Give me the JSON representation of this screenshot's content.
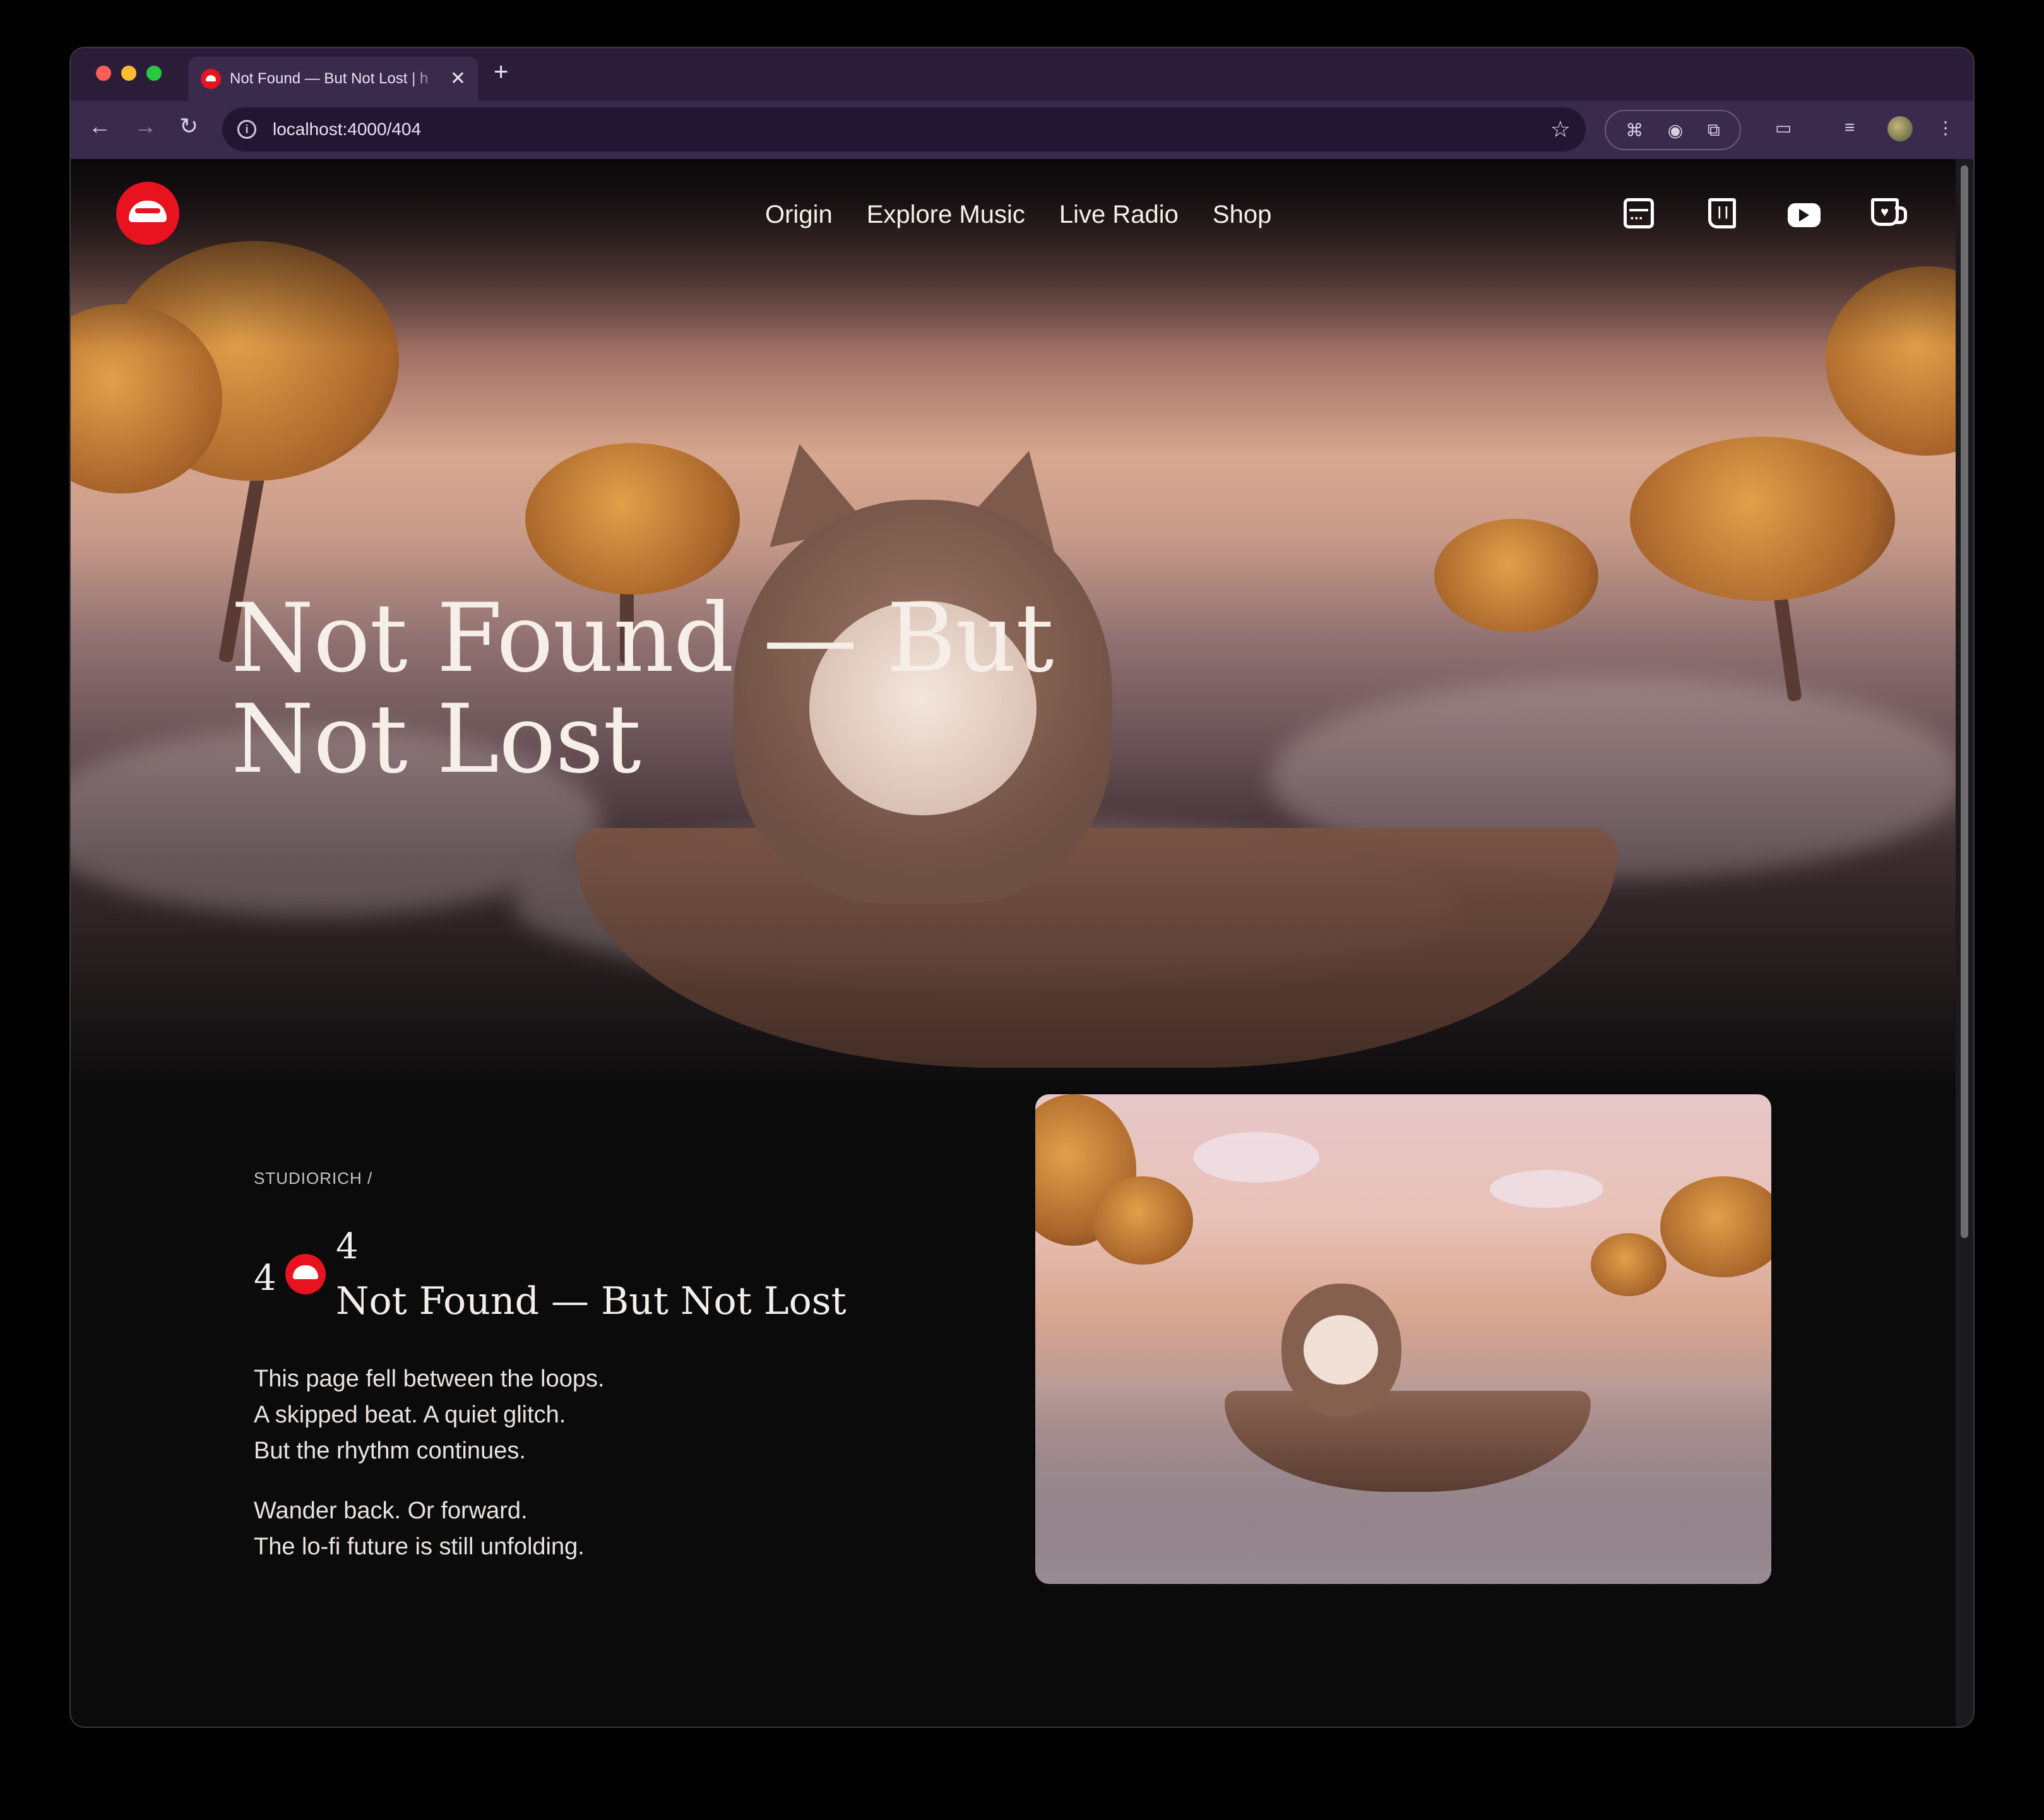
{
  "browser": {
    "tab_title": "Not Found — But Not Lost | h",
    "tab_close": "✕",
    "new_tab": "+",
    "url": "localhost:4000/404",
    "back": "←",
    "forward": "→",
    "reload": "↻",
    "bookmark": "☆",
    "menu": "⋮"
  },
  "site": {
    "nav": [
      "Origin",
      "Explore Music",
      "Live Radio",
      "Shop"
    ],
    "social_icons": [
      "calendar-icon",
      "twitch-icon",
      "youtube-icon",
      "coffee-cup-icon"
    ]
  },
  "hero": {
    "title_line1": "Not Found — But",
    "title_line2": "Not Lost"
  },
  "content": {
    "breadcrumb": "STUDIORICH /",
    "heading_four_a": "4",
    "heading_four_b": "4",
    "heading_text": "Not Found — But Not Lost",
    "para1": [
      "This page fell between the loops.",
      "A skipped beat. A quiet glitch.",
      "But the rhythm continues."
    ],
    "para2": [
      "Wander back. Or forward.",
      "The lo-fi future is still unfolding."
    ]
  },
  "colors": {
    "brand_red": "#e8131f",
    "page_bg": "#0b0b0c",
    "browser_chrome": "#3a2a4c"
  }
}
